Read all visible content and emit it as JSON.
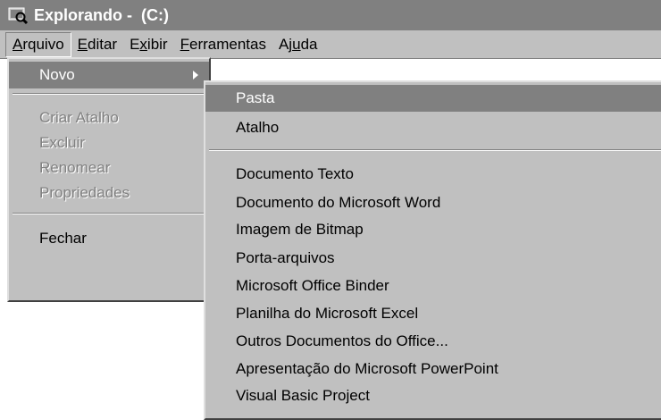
{
  "window": {
    "title": "Explorando -  (C:)"
  },
  "menubar": {
    "items": [
      {
        "label": "Arquivo"
      },
      {
        "label": "Editar"
      },
      {
        "label": "Exibir"
      },
      {
        "label": "Ferramentas"
      },
      {
        "label": "Ajuda"
      }
    ]
  },
  "arquivo_menu": {
    "novo": "Novo",
    "criar_atalho": "Criar Atalho",
    "excluir": "Excluir",
    "renomear": "Renomear",
    "propriedades": "Propriedades",
    "fechar": "Fechar"
  },
  "novo_menu": {
    "pasta": "Pasta",
    "atalho": "Atalho",
    "items": [
      "Documento Texto",
      "Documento do Microsoft Word",
      "Imagem de Bitmap",
      "Porta-arquivos",
      "Microsoft Office Binder",
      "Planilha do Microsoft Excel",
      "Outros Documentos do Office...",
      "Apresentação do Microsoft PowerPoint",
      "Visual Basic Project"
    ]
  },
  "icons": {
    "title": "explorer-magnifier-icon",
    "submenu": "submenu-arrow-icon"
  },
  "colors": {
    "titlebar": "#808080",
    "menu_bg": "#c0c0c0",
    "highlight": "#808080"
  }
}
